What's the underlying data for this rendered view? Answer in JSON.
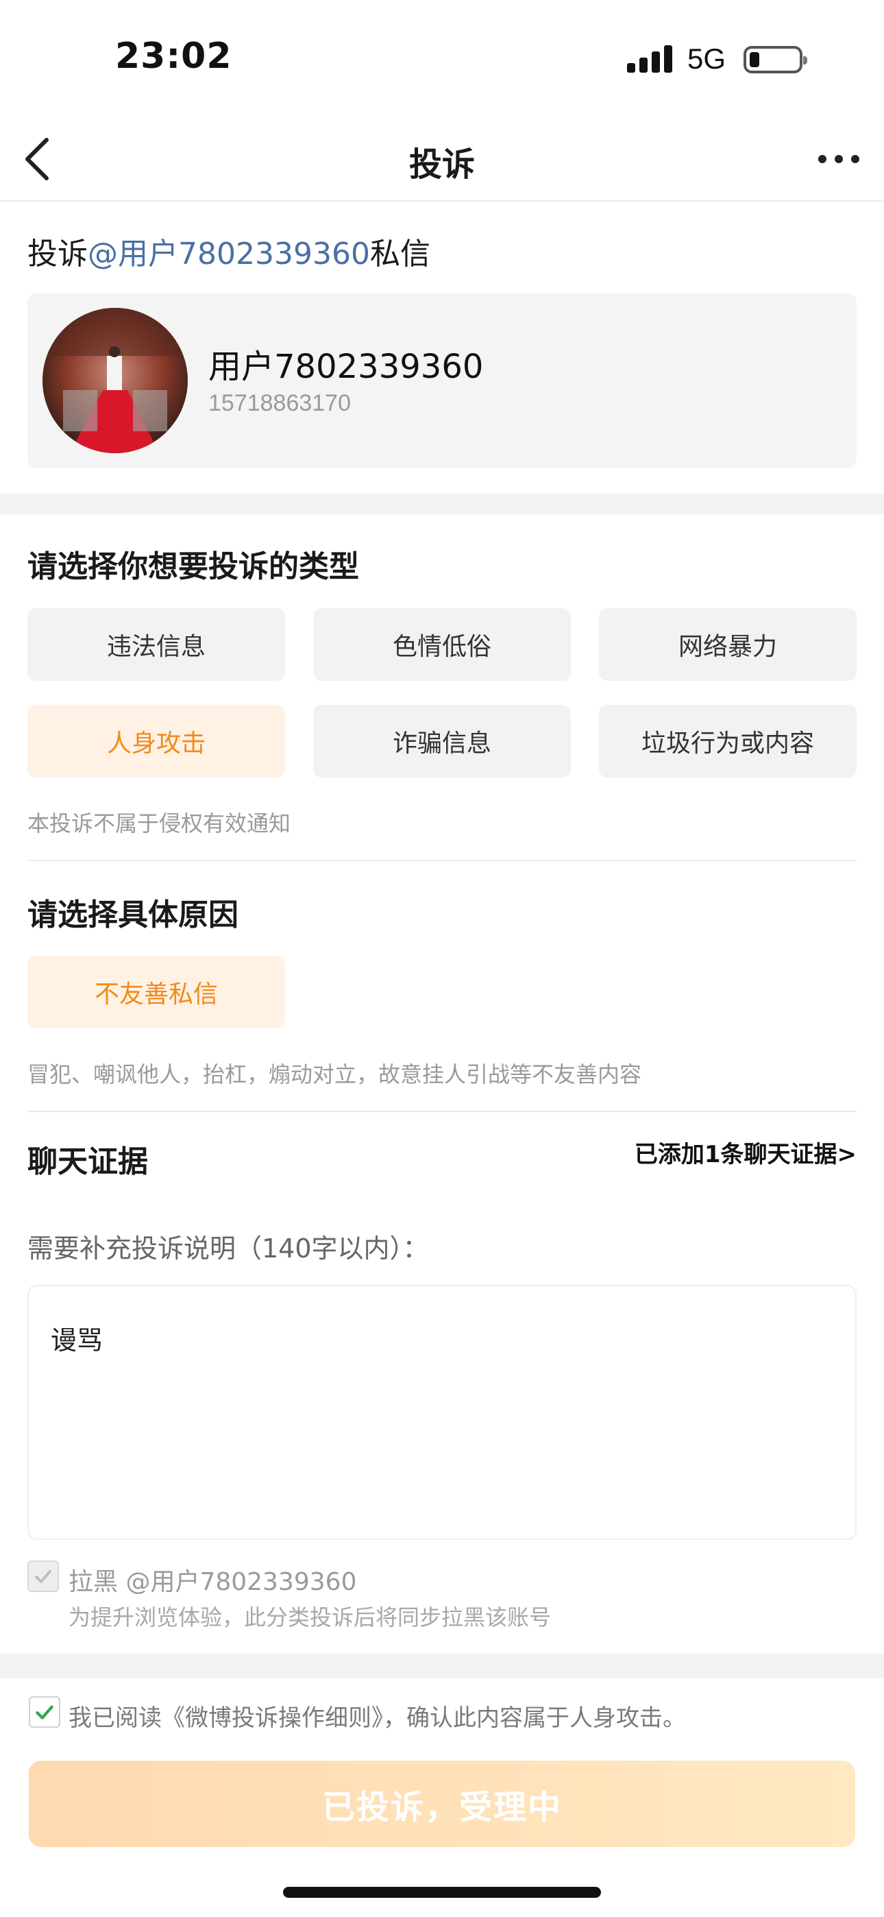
{
  "status_bar": {
    "time": "23:02",
    "network": "5G",
    "icons": [
      "signal-icon",
      "battery-icon"
    ]
  },
  "nav": {
    "title": "投诉",
    "back_icon": "chevron-left-icon",
    "more_icon": "more-dots-icon"
  },
  "target": {
    "prefix": "投诉",
    "mention": "@用户7802339360",
    "suffix": "私信"
  },
  "user_card": {
    "name": "用户7802339360",
    "id": "15718863170"
  },
  "complaint_type": {
    "title": "请选择你想要投诉的类型",
    "options": [
      "违法信息",
      "色情低俗",
      "网络暴力",
      "人身攻击",
      "诈骗信息",
      "垃圾行为或内容"
    ],
    "selected": "人身攻击",
    "note": "本投诉不属于侵权有效通知"
  },
  "reason": {
    "title": "请选择具体原因",
    "selected": "不友善私信",
    "description": "冒犯、嘲讽他人，抬杠，煽动对立，故意挂人引战等不友善内容"
  },
  "evidence": {
    "title": "聊天证据",
    "link": "已添加1条聊天证据>"
  },
  "explanation": {
    "label": "需要补充投诉说明（140字以内）：",
    "value": "谩骂"
  },
  "block": {
    "checked": true,
    "label": "拉黑 @用户7802339360",
    "note": "为提升浏览体验，此分类投诉后将同步拉黑该账号"
  },
  "agreement": {
    "checked": true,
    "text": "我已阅读《微博投诉操作细则》，确认此内容属于人身攻击。"
  },
  "submit": {
    "label": "已投诉，受理中"
  },
  "colors": {
    "accent_orange": "#f38a1c",
    "mention_blue": "#4a6fa5",
    "check_green": "#2ea84a"
  }
}
